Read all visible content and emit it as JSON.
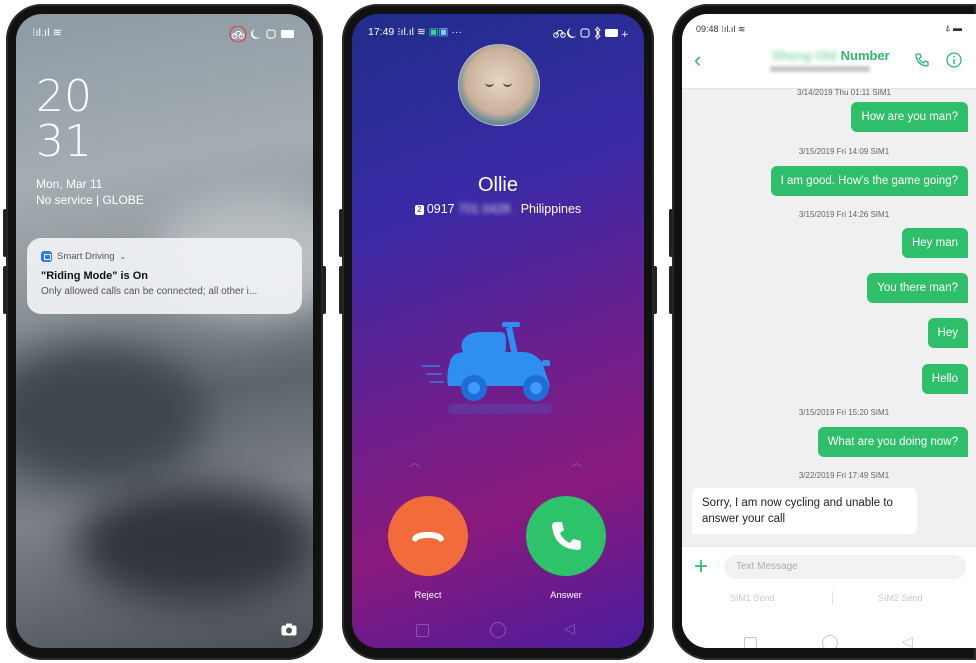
{
  "lockscreen": {
    "status": {
      "left": "⁝ıl.ıl ≋",
      "right": "🚲☾ ▭"
    },
    "clock_hour": "20",
    "clock_minute": "31",
    "date": "Mon, Mar 11",
    "network": "No service | GLOBE",
    "notification": {
      "app": "Smart Driving",
      "title": "\"Riding Mode\" is On",
      "body": "Only allowed calls can be connected; all other i..."
    }
  },
  "incoming_call": {
    "status_time": "17:49",
    "caller_name": "Ollie",
    "sim_badge": "2",
    "number_prefix": "0917",
    "number_hidden": "701 0428",
    "location": "Philippines",
    "reject_label": "Reject",
    "answer_label": "Answer",
    "colors": {
      "reject": "#f26b3a",
      "answer": "#2dc36a",
      "scooter": "#2f8ff0"
    }
  },
  "messages": {
    "status_time": "09:48",
    "contact_title": "Number",
    "contact_hidden": "Sheng Old",
    "thread": [
      {
        "stamp": "3/14/2019 Thu 01:11  SIM1",
        "text": "How are you man?"
      },
      {
        "stamp": "3/15/2019 Fri 14:09  SIM1",
        "text": "I am good. How's the game going?"
      },
      {
        "stamp": "3/15/2019 Fri 14:26  SIM1",
        "text": "Hey man"
      },
      {
        "text": "You there man?"
      },
      {
        "text": "Hey"
      },
      {
        "text": "Hello"
      },
      {
        "stamp": "3/15/2019 Fri 15:20  SIM1",
        "text": "What are you doing now?"
      }
    ],
    "reply_stamp": "3/22/2019 Fri 17:49  SIM1",
    "reply_text": "Sorry, I am now cycling and unable to answer your call",
    "input_placeholder": "Text Message",
    "sim1_send": "SIM1 Send",
    "sim2_send": "SIM2 Send",
    "accent": "#2fbf6a"
  }
}
